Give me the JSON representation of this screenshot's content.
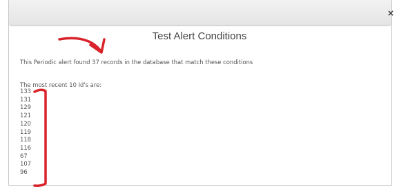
{
  "dialog": {
    "close_label": "×",
    "title": "Test Alert Conditions",
    "summary": "This Periodic alert found 37 records in the database that match these conditions",
    "recent_heading": "The most recent 10 Id's are:",
    "ids": [
      "133",
      "131",
      "129",
      "121",
      "120",
      "119",
      "118",
      "116",
      "67",
      "107",
      "96"
    ]
  },
  "annotation": {
    "color": "#d9232a"
  }
}
